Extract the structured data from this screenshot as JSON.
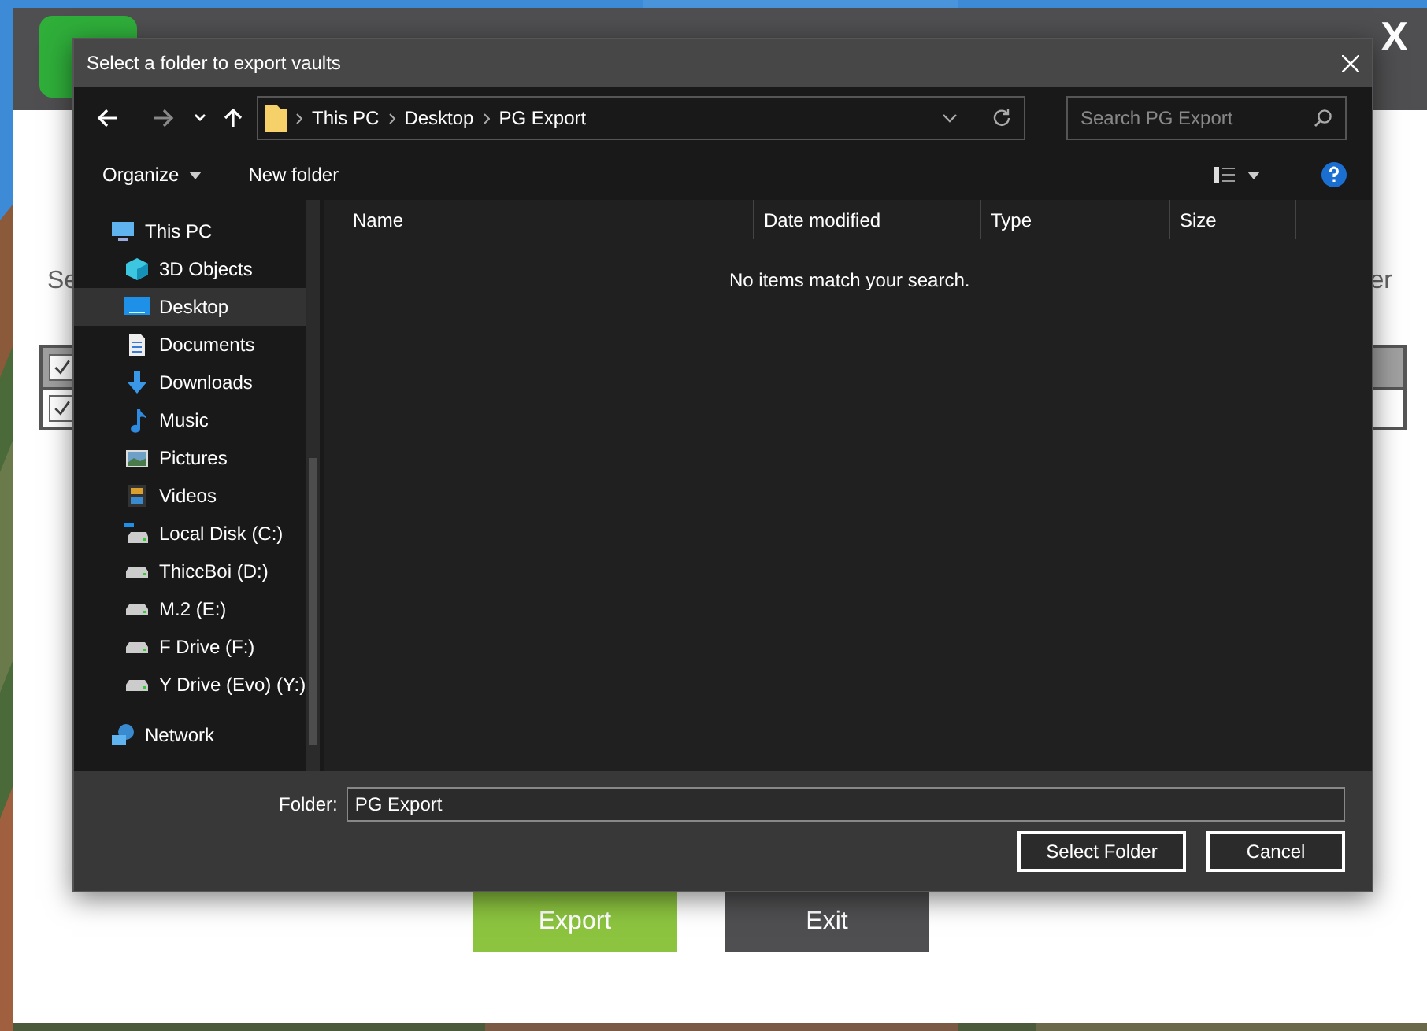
{
  "app": {
    "close": "X",
    "fragment_left": "Se",
    "fragment_right": "er",
    "rows": [
      {
        "checked": true,
        "selected": true
      },
      {
        "checked": true,
        "selected": false
      }
    ],
    "buttons": [
      {
        "label": "Export",
        "kind": "primary"
      },
      {
        "label": "Exit",
        "kind": "secondary"
      }
    ]
  },
  "dialog": {
    "title": "Select a folder to export vaults",
    "path": [
      "This PC",
      "Desktop",
      "PG Export"
    ],
    "search": {
      "placeholder": "Search PG Export"
    },
    "toolbar": [
      "Organize",
      "New folder"
    ],
    "sidebar": [
      {
        "label": "This PC",
        "kind": "pc",
        "selected": false,
        "children": [
          {
            "label": "3D Objects",
            "kind": "cube",
            "selected": false
          },
          {
            "label": "Desktop",
            "kind": "desktop",
            "selected": true
          },
          {
            "label": "Documents",
            "kind": "document",
            "selected": false
          },
          {
            "label": "Downloads",
            "kind": "download",
            "selected": false
          },
          {
            "label": "Music",
            "kind": "music",
            "selected": false
          },
          {
            "label": "Pictures",
            "kind": "pictures",
            "selected": false
          },
          {
            "label": "Videos",
            "kind": "videos",
            "selected": false
          },
          {
            "label": "Local Disk (C:)",
            "kind": "system",
            "selected": false
          },
          {
            "label": "ThiccBoi (D:)",
            "kind": "drive",
            "selected": false
          },
          {
            "label": "M.2 (E:)",
            "kind": "drive",
            "selected": false
          },
          {
            "label": "F Drive (F:)",
            "kind": "drive",
            "selected": false
          },
          {
            "label": "Y Drive (Evo) (Y:)",
            "kind": "drive",
            "selected": false
          }
        ]
      },
      {
        "label": "Network",
        "kind": "network",
        "selected": false
      }
    ],
    "columns": [
      "Name",
      "Date modified",
      "Type",
      "Size"
    ],
    "empty_message": "No items match your search.",
    "folder_label": "Folder:",
    "folder_value": "PG Export",
    "buttons": [
      "Select Folder",
      "Cancel"
    ]
  }
}
